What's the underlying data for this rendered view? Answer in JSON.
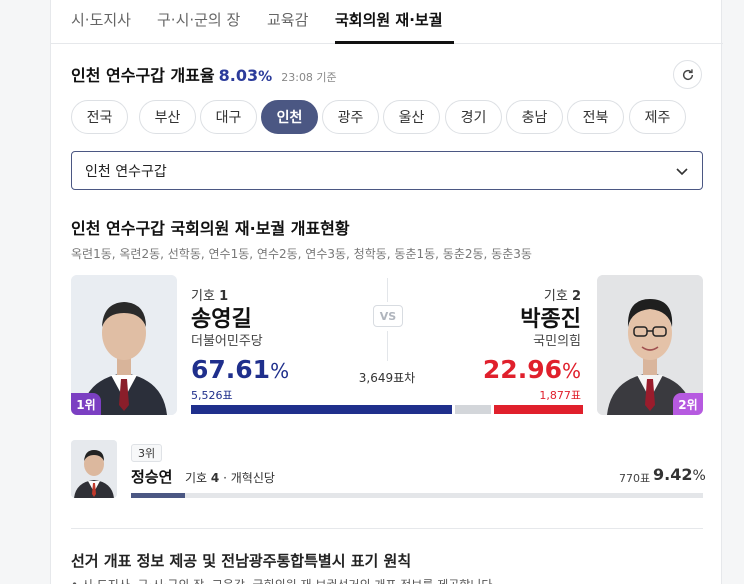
{
  "tabs": [
    {
      "label": "시·도지사"
    },
    {
      "label": "구·시·군의 장"
    },
    {
      "label": "교육감"
    },
    {
      "label": "국회의원 재·보궐"
    }
  ],
  "header": {
    "title": "인천 연수구갑 개표율",
    "rate": "8.03",
    "rate_unit": "%",
    "time": "23:08 기준"
  },
  "regions": [
    {
      "label": "전국"
    },
    {
      "label": "부산"
    },
    {
      "label": "대구"
    },
    {
      "label": "인천"
    },
    {
      "label": "광주"
    },
    {
      "label": "울산"
    },
    {
      "label": "경기"
    },
    {
      "label": "충남"
    },
    {
      "label": "전북"
    },
    {
      "label": "제주"
    }
  ],
  "selected_region": "인천",
  "district_select": {
    "value": "인천 연수구갑"
  },
  "section": {
    "title": "인천 연수구갑 국회의원 재·보궐 개표현황",
    "dongs": "옥련1동, 옥련2동, 선학동, 연수1동, 연수2동, 연수3동, 청학동, 동춘1동, 동춘2동, 동춘3동"
  },
  "candidate1": {
    "num_prefix": "기호",
    "num": "1",
    "name": "송영길",
    "party": "더불어민주당",
    "pct": "67.61",
    "pct_unit": "%",
    "votes": "5,526표",
    "rank": "1위",
    "color": "#1f2f8c"
  },
  "candidate2": {
    "num_prefix": "기호",
    "num": "2",
    "name": "박종진",
    "party": "국민의힘",
    "pct": "22.96",
    "pct_unit": "%",
    "votes": "1,877표",
    "rank": "2위",
    "color": "#e0202c"
  },
  "vs_label": "VS",
  "vote_diff": "3,649표차",
  "candidate3": {
    "rank": "3위",
    "name": "정승연",
    "num_prefix": "기호",
    "num": "4",
    "party": "· 개혁신당",
    "votes": "770표",
    "pct": "9.42",
    "pct_unit": "%"
  },
  "share_bar": {
    "c1": 67.61,
    "other": 9.42,
    "c2": 22.96
  },
  "notice": {
    "title": "선거 개표 정보 제공 및 전남광주통합특별시 표기 원칙",
    "text": "• 시·도지사, 구·시·군의 장, 교육감, 국회의원 재·보궐선거의 개표 정보를 제공합니다."
  },
  "colors": {
    "accent": "#4b5783",
    "blue": "#1f2f8c",
    "red": "#e0202c"
  }
}
